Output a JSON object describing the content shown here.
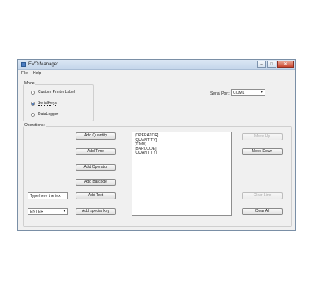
{
  "window": {
    "title": "EVO Manager"
  },
  "menu": [
    "File",
    "Help"
  ],
  "mode": {
    "label": "Mode",
    "options": [
      {
        "label": "Custom Printer Label",
        "selected": false
      },
      {
        "label": "SerialKeys",
        "selected": true
      },
      {
        "label": "DataLogger",
        "selected": false
      }
    ]
  },
  "serial_port": {
    "label": "Serial Port:",
    "value": "COM1"
  },
  "operations": {
    "label": "Operations:",
    "buttons": {
      "add_quantity": "Add Quantity",
      "add_time": "Add Time",
      "add_operator": "Add Operator",
      "add_barcode": "Add Barcode",
      "add_text": "Add Text",
      "add_special_key": "Add special key"
    },
    "text_input": "Type here the text",
    "key_select": "ENTER",
    "list_items": [
      "[OPERATOR]",
      "[QUANTITY]",
      "[TIME]",
      "[BARCODE]",
      "[QUANTITY]"
    ],
    "move_up": "Move Up",
    "move_down": "Move Down",
    "clear_line": "Clear Line",
    "clear_all": "Clear All"
  }
}
